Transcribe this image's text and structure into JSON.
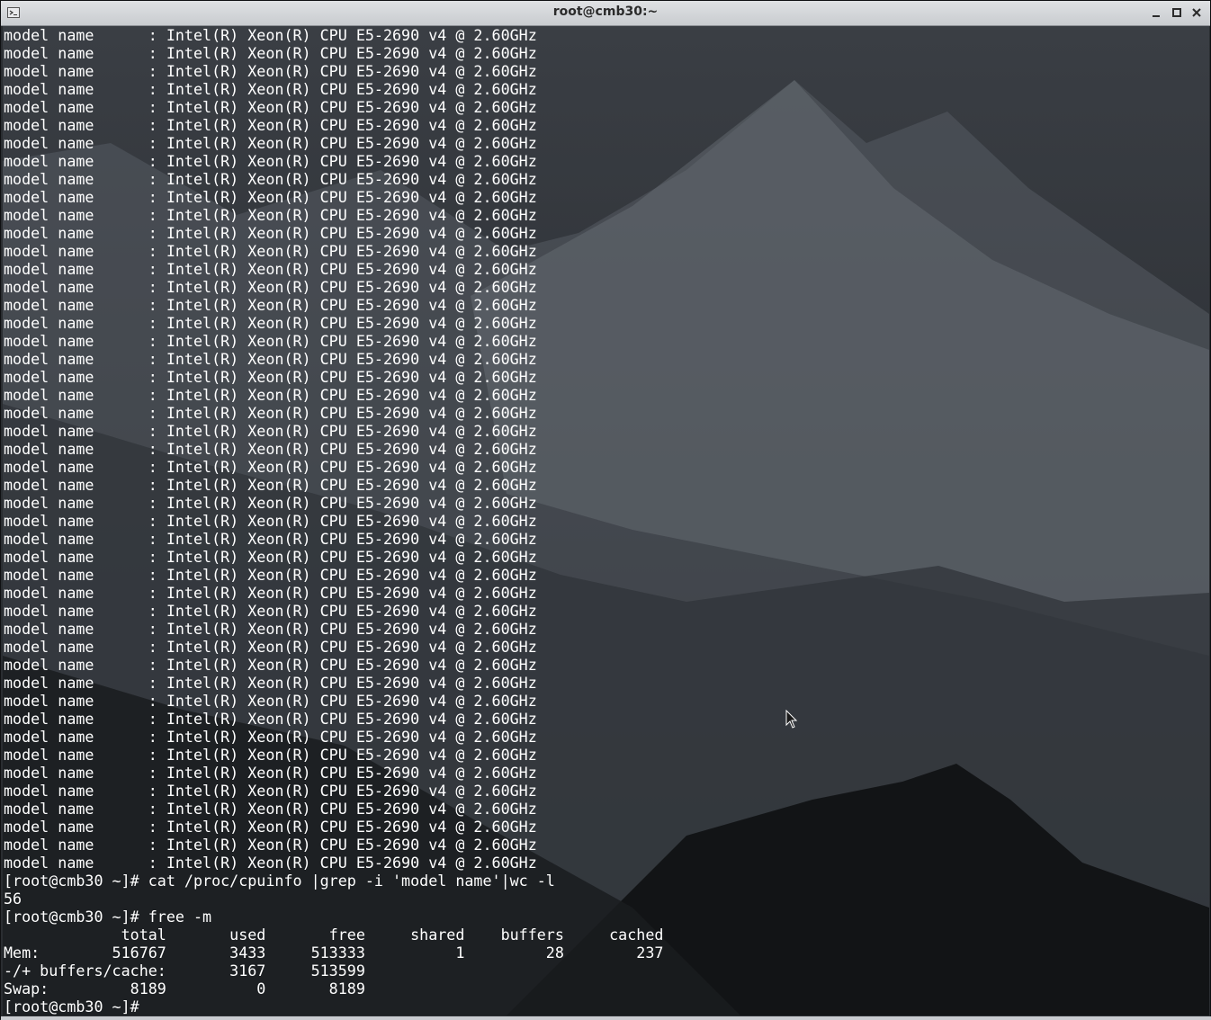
{
  "window": {
    "title": "root@cmb30:~",
    "icons": {
      "app": "terminal-icon",
      "minimize": "minimize-icon",
      "maximize": "maximize-icon",
      "close": "close-icon"
    },
    "colors": {
      "titlebar": "#d6d8db",
      "text": "#ffffff"
    }
  },
  "terminal": {
    "cpu_line": "model name      : Intel(R) Xeon(R) CPU E5-2690 v4 @ 2.60GHz",
    "cpu_line_count_visible": 47,
    "lines_after": [
      "[root@cmb30 ~]# cat /proc/cpuinfo |grep -i 'model name'|wc -l",
      "56",
      "[root@cmb30 ~]# free -m",
      "             total       used       free     shared    buffers     cached",
      "Mem:        516767       3433     513333          1         28        237",
      "-/+ buffers/cache:       3167     513599",
      "Swap:         8189          0       8189",
      "[root@cmb30 ~]# "
    ]
  }
}
